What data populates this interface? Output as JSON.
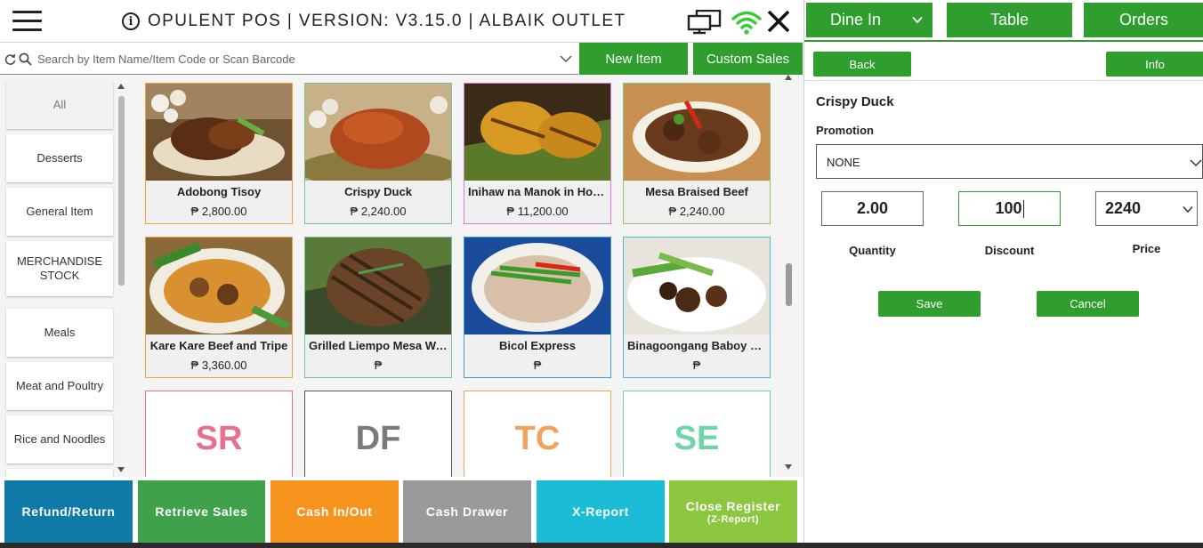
{
  "header": {
    "title": "OPULENT POS | VERSION: V3.15.0 | ALBAIK OUTLET"
  },
  "search": {
    "placeholder": "Search by Item Name/Item Code or Scan Barcode"
  },
  "actions": {
    "new_item": "New Item",
    "custom_sales": "Custom Sales"
  },
  "categories": [
    {
      "label": "All"
    },
    {
      "label": "Desserts"
    },
    {
      "label": "General Item"
    },
    {
      "label": "MERCHANDISE STOCK"
    },
    {
      "label": "Meals"
    },
    {
      "label": "Meat and Poultry"
    },
    {
      "label": "Rice and Noodles"
    }
  ],
  "items": [
    {
      "name": "Adobong Tisoy",
      "price": "₱ 2,800.00",
      "border": "#f2a33a"
    },
    {
      "name": "Crispy Duck",
      "price": "₱ 2,240.00",
      "border": "#6fc59a"
    },
    {
      "name": "Inihaw na Manok in Honey",
      "price": "₱ 11,200.00",
      "border": "#e07ad6"
    },
    {
      "name": "Mesa Braised Beef",
      "price": "₱ 2,240.00",
      "border": "#8cc56f"
    },
    {
      "name": "Kare Kare Beef and Tripe",
      "price": "₱ 3,360.00",
      "border": "#f2a33a"
    },
    {
      "name": "Grilled Liempo Mesa Way",
      "price": "₱",
      "border": "#6fc59a"
    },
    {
      "name": "Bicol Express",
      "price": "₱",
      "border": "#3a9ad6"
    },
    {
      "name": "Binagoongang Baboy ni ...",
      "price": "₱",
      "border": "#5ab8d6"
    }
  ],
  "abbr_items": [
    {
      "abbr": "SR",
      "color": "#e8708a",
      "border": "#e8708a"
    },
    {
      "abbr": "DF",
      "color": "#7a7a7a",
      "border": "#555555"
    },
    {
      "abbr": "TC",
      "color": "#f2a35a",
      "border": "#f2a35a"
    },
    {
      "abbr": "SE",
      "color": "#6fd4a8",
      "border": "#6fd4a8"
    }
  ],
  "bottom_buttons": [
    {
      "label": "Refund/Return",
      "sub": "",
      "color": "#0f7aa8"
    },
    {
      "label": "Retrieve Sales",
      "sub": "",
      "color": "#3fa24a"
    },
    {
      "label": "Cash In/Out",
      "sub": "",
      "color": "#f7941d"
    },
    {
      "label": "Cash Drawer",
      "sub": "",
      "color": "#9a9a9a"
    },
    {
      "label": "X-Report",
      "sub": "",
      "color": "#1bbcd6"
    },
    {
      "label": "Close Register",
      "sub": "(Z-Report)",
      "color": "#8dc63f"
    }
  ],
  "right_tabs": {
    "dine_in": "Dine In",
    "table": "Table",
    "orders": "Orders"
  },
  "detail": {
    "back": "Back",
    "info": "Info",
    "product_name": "Crispy Duck",
    "promotion_label": "Promotion",
    "promotion_value": "NONE",
    "quantity_value": "2.00",
    "discount_value": "100",
    "price_value": "2240",
    "quantity_label": "Quantity",
    "discount_label": "Discount",
    "price_label": "Price",
    "save": "Save",
    "cancel": "Cancel"
  },
  "colors": {
    "accent_green": "#2f9e2f"
  },
  "icons": [
    "menu-icon",
    "info-icon",
    "monitor-icon",
    "wifi-icon",
    "close-icon",
    "refresh-icon",
    "search-icon",
    "chevron-down-icon"
  ]
}
